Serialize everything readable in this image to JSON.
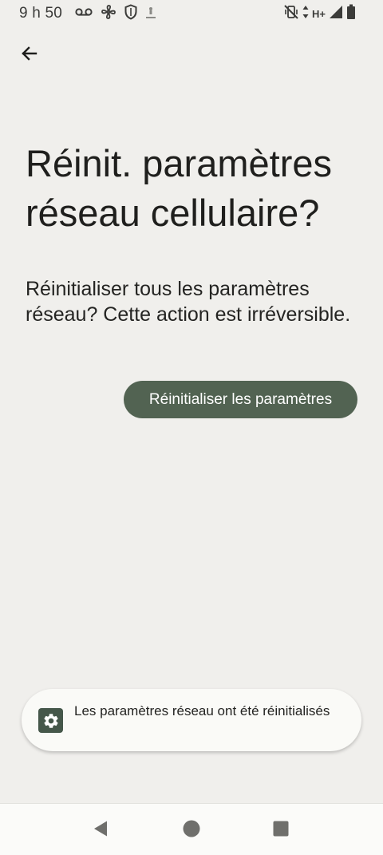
{
  "status_bar": {
    "time": "9 h 50",
    "network_type": "H+",
    "left_icons": [
      "voicemail-icon",
      "fan-icon",
      "shield-icon",
      "download-icon"
    ],
    "right_icons": [
      "vibrate-off-icon",
      "data-arrows-icon",
      "signal-icon",
      "battery-icon"
    ]
  },
  "header": {
    "back_icon": "arrow-left-icon"
  },
  "main": {
    "title": "Réinit. paramètres réseau cellulaire?",
    "description": "Réinitialiser tous les paramètres réseau? Cette action est irréversible.",
    "reset_button_label": "Réinitialiser les paramètres"
  },
  "toast": {
    "icon": "gear-icon",
    "message": "Les paramètres réseau ont été réinitialisés"
  },
  "nav_bar": {
    "buttons": [
      "back-triangle-icon",
      "home-circle-icon",
      "recents-square-icon"
    ]
  },
  "colors": {
    "background": "#f0efec",
    "accent_button": "#526352",
    "toast_background": "#fafaf7",
    "toast_icon_background": "#45574a",
    "text_primary": "#1f1f1d"
  }
}
